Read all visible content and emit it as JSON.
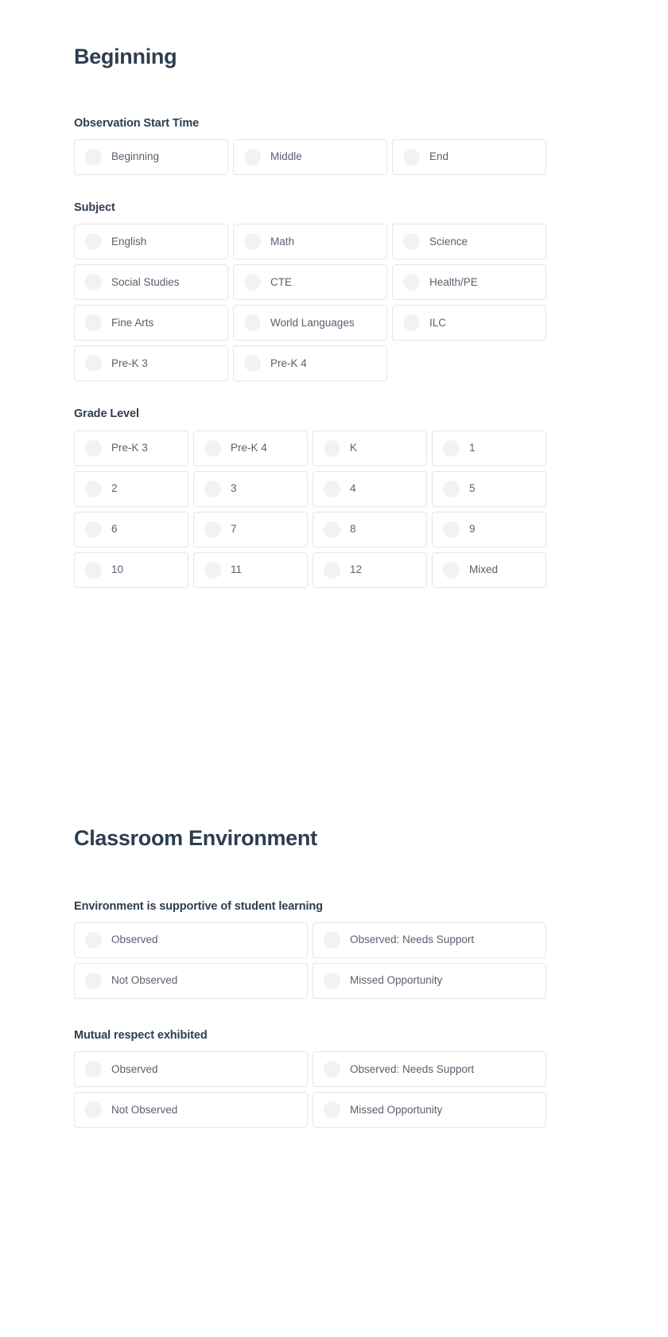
{
  "colors": {
    "heading": "#2e3d50",
    "label_text": "#57616f",
    "card_border": "#e3e6e9",
    "radio_fill": "#f1f2f3",
    "page_background": "#ffffff"
  },
  "sections": [
    {
      "id": "beginning",
      "title": "Beginning",
      "groups": [
        {
          "id": "observation-start-time",
          "label": "Observation Start Time",
          "columns": 3,
          "options": [
            "Beginning",
            "Middle",
            "End"
          ]
        },
        {
          "id": "subject",
          "label": "Subject",
          "columns": 3,
          "options": [
            "English",
            "Math",
            "Science",
            "Social Studies",
            "CTE",
            "Health/PE",
            "Fine Arts",
            "World Languages",
            "ILC",
            "Pre-K 3",
            "Pre-K 4"
          ]
        },
        {
          "id": "grade-level",
          "label": "Grade Level",
          "columns": 4,
          "options": [
            "Pre-K 3",
            "Pre-K 4",
            "K",
            "1",
            "2",
            "3",
            "4",
            "5",
            "6",
            "7",
            "8",
            "9",
            "10",
            "11",
            "12",
            "Mixed"
          ]
        }
      ]
    },
    {
      "id": "classroom-environment",
      "title": "Classroom Environment",
      "groups": [
        {
          "id": "environment-supportive",
          "label": "Environment is supportive of student learning",
          "columns": 2,
          "options": [
            "Observed",
            "Observed: Needs Support",
            "Not Observed",
            "Missed Opportunity"
          ]
        },
        {
          "id": "mutual-respect",
          "label": "Mutual respect exhibited",
          "columns": 2,
          "options": [
            "Observed",
            "Observed: Needs Support",
            "Not Observed",
            "Missed Opportunity"
          ]
        }
      ]
    }
  ]
}
